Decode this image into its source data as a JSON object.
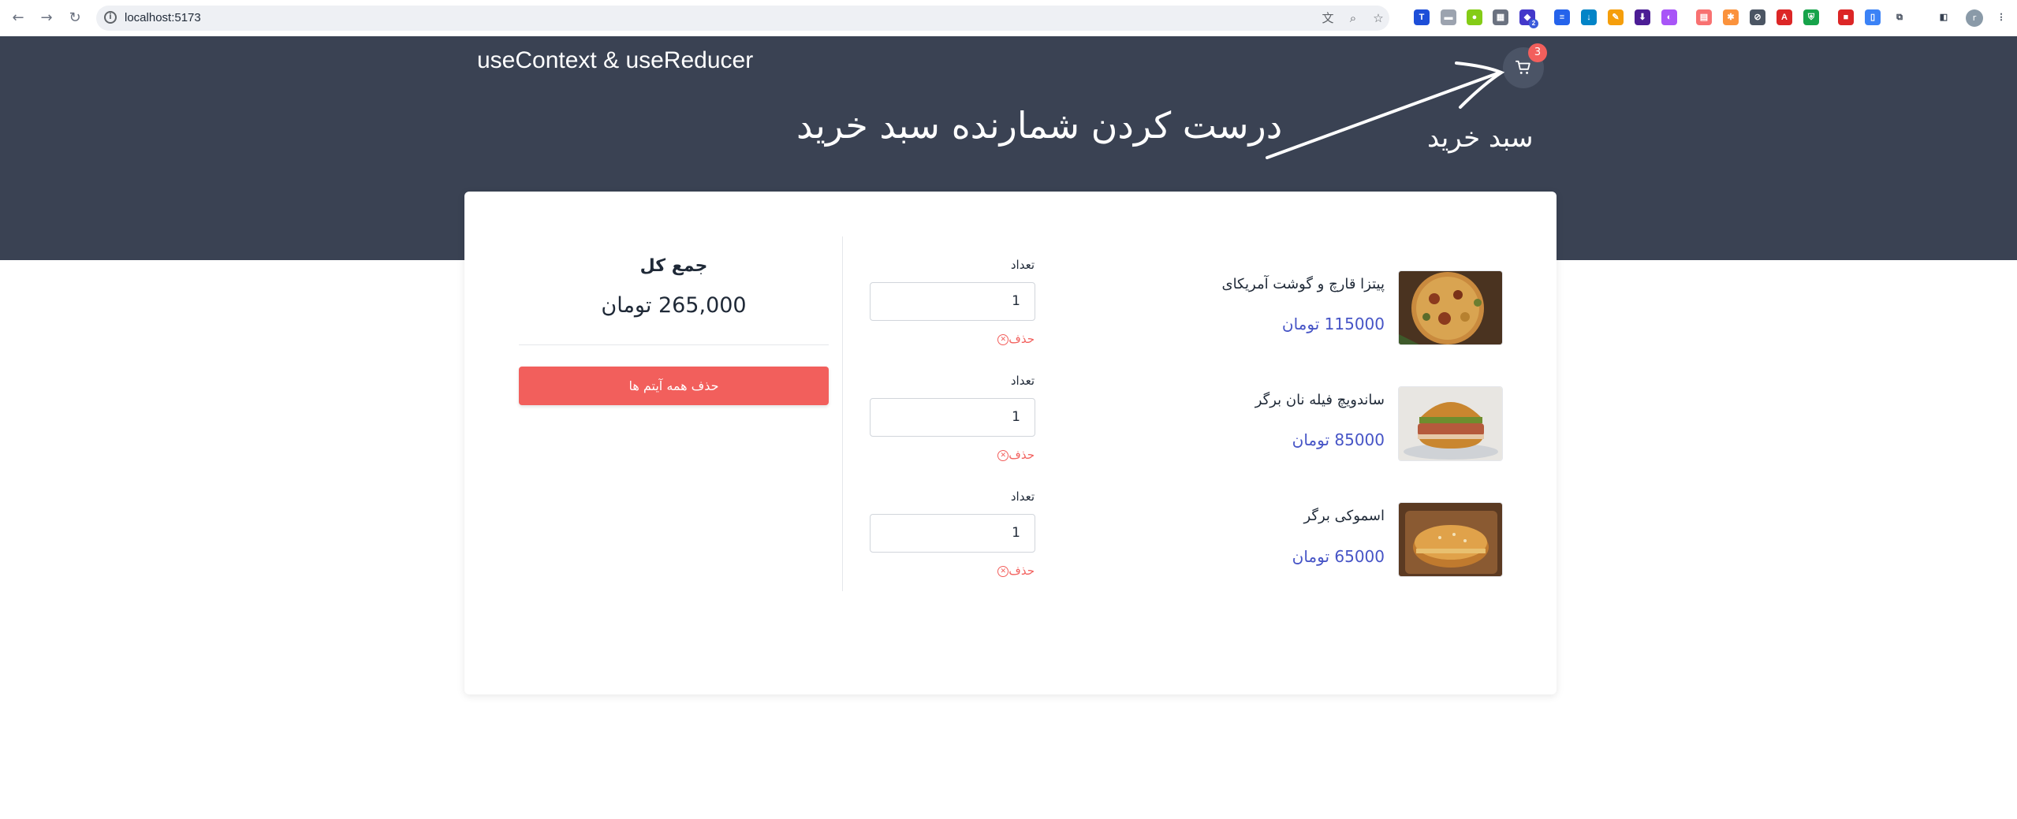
{
  "browser": {
    "url": "localhost:5173",
    "extension_badge": "2",
    "profile_initial": "r"
  },
  "header": {
    "brand": "useContext & useReducer",
    "cart_count": "3"
  },
  "annotation": {
    "main_text": "درست کردن شمارنده سبد خرید",
    "cart_text": "سبد خرید"
  },
  "summary": {
    "title": "جمع کل",
    "total": "265,000 تومان",
    "clear_all_label": "حذف همه آیتم ها"
  },
  "items": [
    {
      "name": "پیتزا قارچ و گوشت آمریکای",
      "price": "115000 تومان",
      "qty_label": "تعداد",
      "qty": "1",
      "delete_label": "حذف"
    },
    {
      "name": "ساندویچ فیله نان برگر",
      "price": "85000 تومان",
      "qty_label": "تعداد",
      "qty": "1",
      "delete_label": "حذف"
    },
    {
      "name": "اسموکی برگر",
      "price": "65000 تومان",
      "qty_label": "تعداد",
      "qty": "1",
      "delete_label": "حذف"
    }
  ],
  "colors": {
    "header_bg": "#3a4253",
    "accent_red": "#f25f5c",
    "price_blue": "#4654c6"
  }
}
